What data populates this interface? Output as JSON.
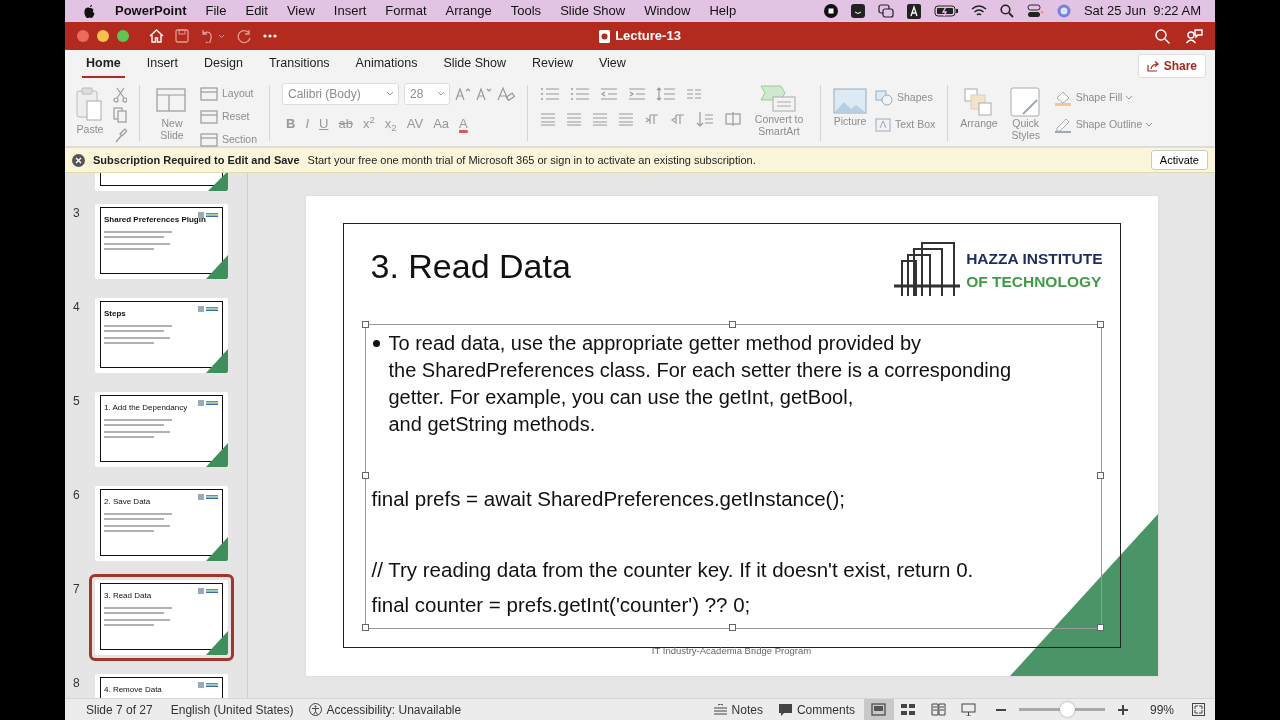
{
  "menu_bar": {
    "app": "PowerPoint",
    "items": [
      "File",
      "Edit",
      "View",
      "Insert",
      "Format",
      "Arrange",
      "Tools",
      "Slide Show",
      "Window",
      "Help"
    ],
    "clock": "Sat 25 Jun  9:22 AM"
  },
  "title_bar": {
    "title": "Lecture-13"
  },
  "ribbon_tabs": [
    {
      "label": "Home",
      "selected": true
    },
    {
      "label": "Insert",
      "selected": false
    },
    {
      "label": "Design",
      "selected": false
    },
    {
      "label": "Transitions",
      "selected": false
    },
    {
      "label": "Animations",
      "selected": false
    },
    {
      "label": "Slide Show",
      "selected": false
    },
    {
      "label": "Review",
      "selected": false
    },
    {
      "label": "View",
      "selected": false
    }
  ],
  "share": "Share",
  "ribbon": {
    "disabled": true,
    "paste": "Paste",
    "new_slide": "New Slide",
    "slide_buttons": [
      "Layout",
      "Reset",
      "Section"
    ],
    "font": {
      "name": "Calibri (Body)",
      "size": "28"
    },
    "format_buttons": [
      {
        "label": "B",
        "kind": "bold"
      },
      {
        "label": "I",
        "kind": "italic"
      },
      {
        "label": "U",
        "kind": "underline"
      },
      {
        "label": "ab",
        "kind": "strike"
      },
      {
        "label": "x$^{2}$",
        "kind": "plain"
      },
      {
        "label": "x$_{2}$",
        "kind": "plain"
      },
      {
        "label": "AV",
        "kind": "plain"
      },
      {
        "label": "Aa",
        "kind": "plain"
      },
      {
        "label": "A",
        "kind": "color"
      }
    ],
    "smartart": "Convert to SmartArt",
    "picture": "Picture",
    "shapes": "Shapes",
    "text_box": "Text Box",
    "arrange": "Arrange",
    "quick_styles": "Quick Styles",
    "shape_fill": "Shape Fill",
    "shape_outline": "Shape Outline"
  },
  "notice": {
    "title": "Subscription Required to Edit and Save",
    "message": "Start your free one month trial of Microsoft 365 or sign in to activate an existing subscription.",
    "button": "Activate"
  },
  "slides": [
    {
      "kind": "cut",
      "selected": false
    },
    {
      "kind": "full",
      "number": "3",
      "title": "Shared Preferences Plugin",
      "bold_title": true,
      "selected": false
    },
    {
      "kind": "full",
      "number": "4",
      "title": "Steps",
      "bold_title": true,
      "selected": false
    },
    {
      "kind": "full",
      "number": "5",
      "title": "1. Add the Dependancy",
      "bold_title": false,
      "selected": false
    },
    {
      "kind": "full",
      "number": "6",
      "title": "2. Save Data",
      "bold_title": false,
      "selected": false
    },
    {
      "kind": "full",
      "number": "7",
      "title": "3. Read Data",
      "bold_title": false,
      "selected": true
    },
    {
      "kind": "cut_bottom",
      "number": "8",
      "title": "4. Remove Data",
      "bold_title": false,
      "selected": false
    }
  ],
  "slide": {
    "title": "3. Read Data",
    "logo": [
      "HAZZA INSTITUTE",
      "OF TECHNOLOGY"
    ],
    "bullet": [
      "To read data, use the appropriate getter method provided by",
      "the SharedPreferences class. For each setter there is a corresponding",
      "getter. For example, you can use the getInt, getBool,",
      "and getString methods."
    ],
    "code_blocks": [
      [
        "final prefs = await SharedPreferences.getInstance();"
      ],
      [
        "// Try reading data from the counter key. If it doesn't exist, return 0.",
        "final counter = prefs.getInt('counter') ?? 0;"
      ]
    ],
    "footer": "IT Industry-Academia Bridge Program"
  },
  "status_bar": {
    "slide": "Slide 7 of 27",
    "language": "English (United States)",
    "accessibility": "Accessibility: Unavailable",
    "notes": "Notes",
    "comments": "Comments",
    "views": [
      {
        "kind": "normal",
        "selected": true
      },
      {
        "kind": "sorter",
        "selected": false
      },
      {
        "kind": "reading",
        "selected": false
      },
      {
        "kind": "show",
        "selected": false
      }
    ],
    "zoom": {
      "level": 0.55,
      "reading": "99%"
    }
  }
}
